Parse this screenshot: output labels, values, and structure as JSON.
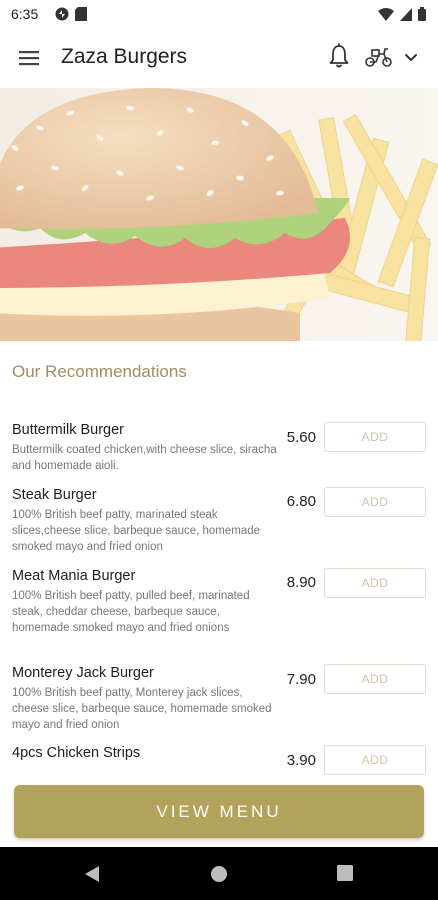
{
  "status_bar": {
    "time": "6:35"
  },
  "app_bar": {
    "title": "Zaza Burgers",
    "icons": [
      "menu-icon",
      "bell-icon",
      "scooter-icon",
      "chevron-down-icon"
    ]
  },
  "section_title": "Our Recommendations",
  "items": [
    {
      "name": "Buttermilk Burger",
      "desc": "Buttermilk coated chicken,with cheese slice, siracha and homemade aioli.",
      "price": "5.60",
      "add_label": "ADD"
    },
    {
      "name": "Steak Burger",
      "desc": "100% British beef patty, marinated steak slices,cheese slice, barbeque sauce, homemade smoked mayo and fried onion",
      "price": "6.80",
      "add_label": "ADD"
    },
    {
      "name": "Meat Mania Burger",
      "desc": "100% British beef patty, pulled beef, marinated steak, cheddar cheese, barbeque sauce, homemade smoked mayo and fried onions",
      "price": "8.90",
      "add_label": "ADD"
    },
    {
      "name": "Monterey Jack Burger",
      "desc": "100% British beef patty, Monterey jack slices, cheese slice, barbeque sauce, homemade smoked mayo and fried onion",
      "price": "7.90",
      "add_label": "ADD"
    },
    {
      "name": "4pcs Chicken Strips",
      "desc": "",
      "price": "3.90",
      "add_label": "ADD"
    }
  ],
  "view_menu_label": "VIEW MENU",
  "colors": {
    "accent": "#b2a25b",
    "section_title": "#a08e63",
    "add_border": "#e3dcc8"
  }
}
